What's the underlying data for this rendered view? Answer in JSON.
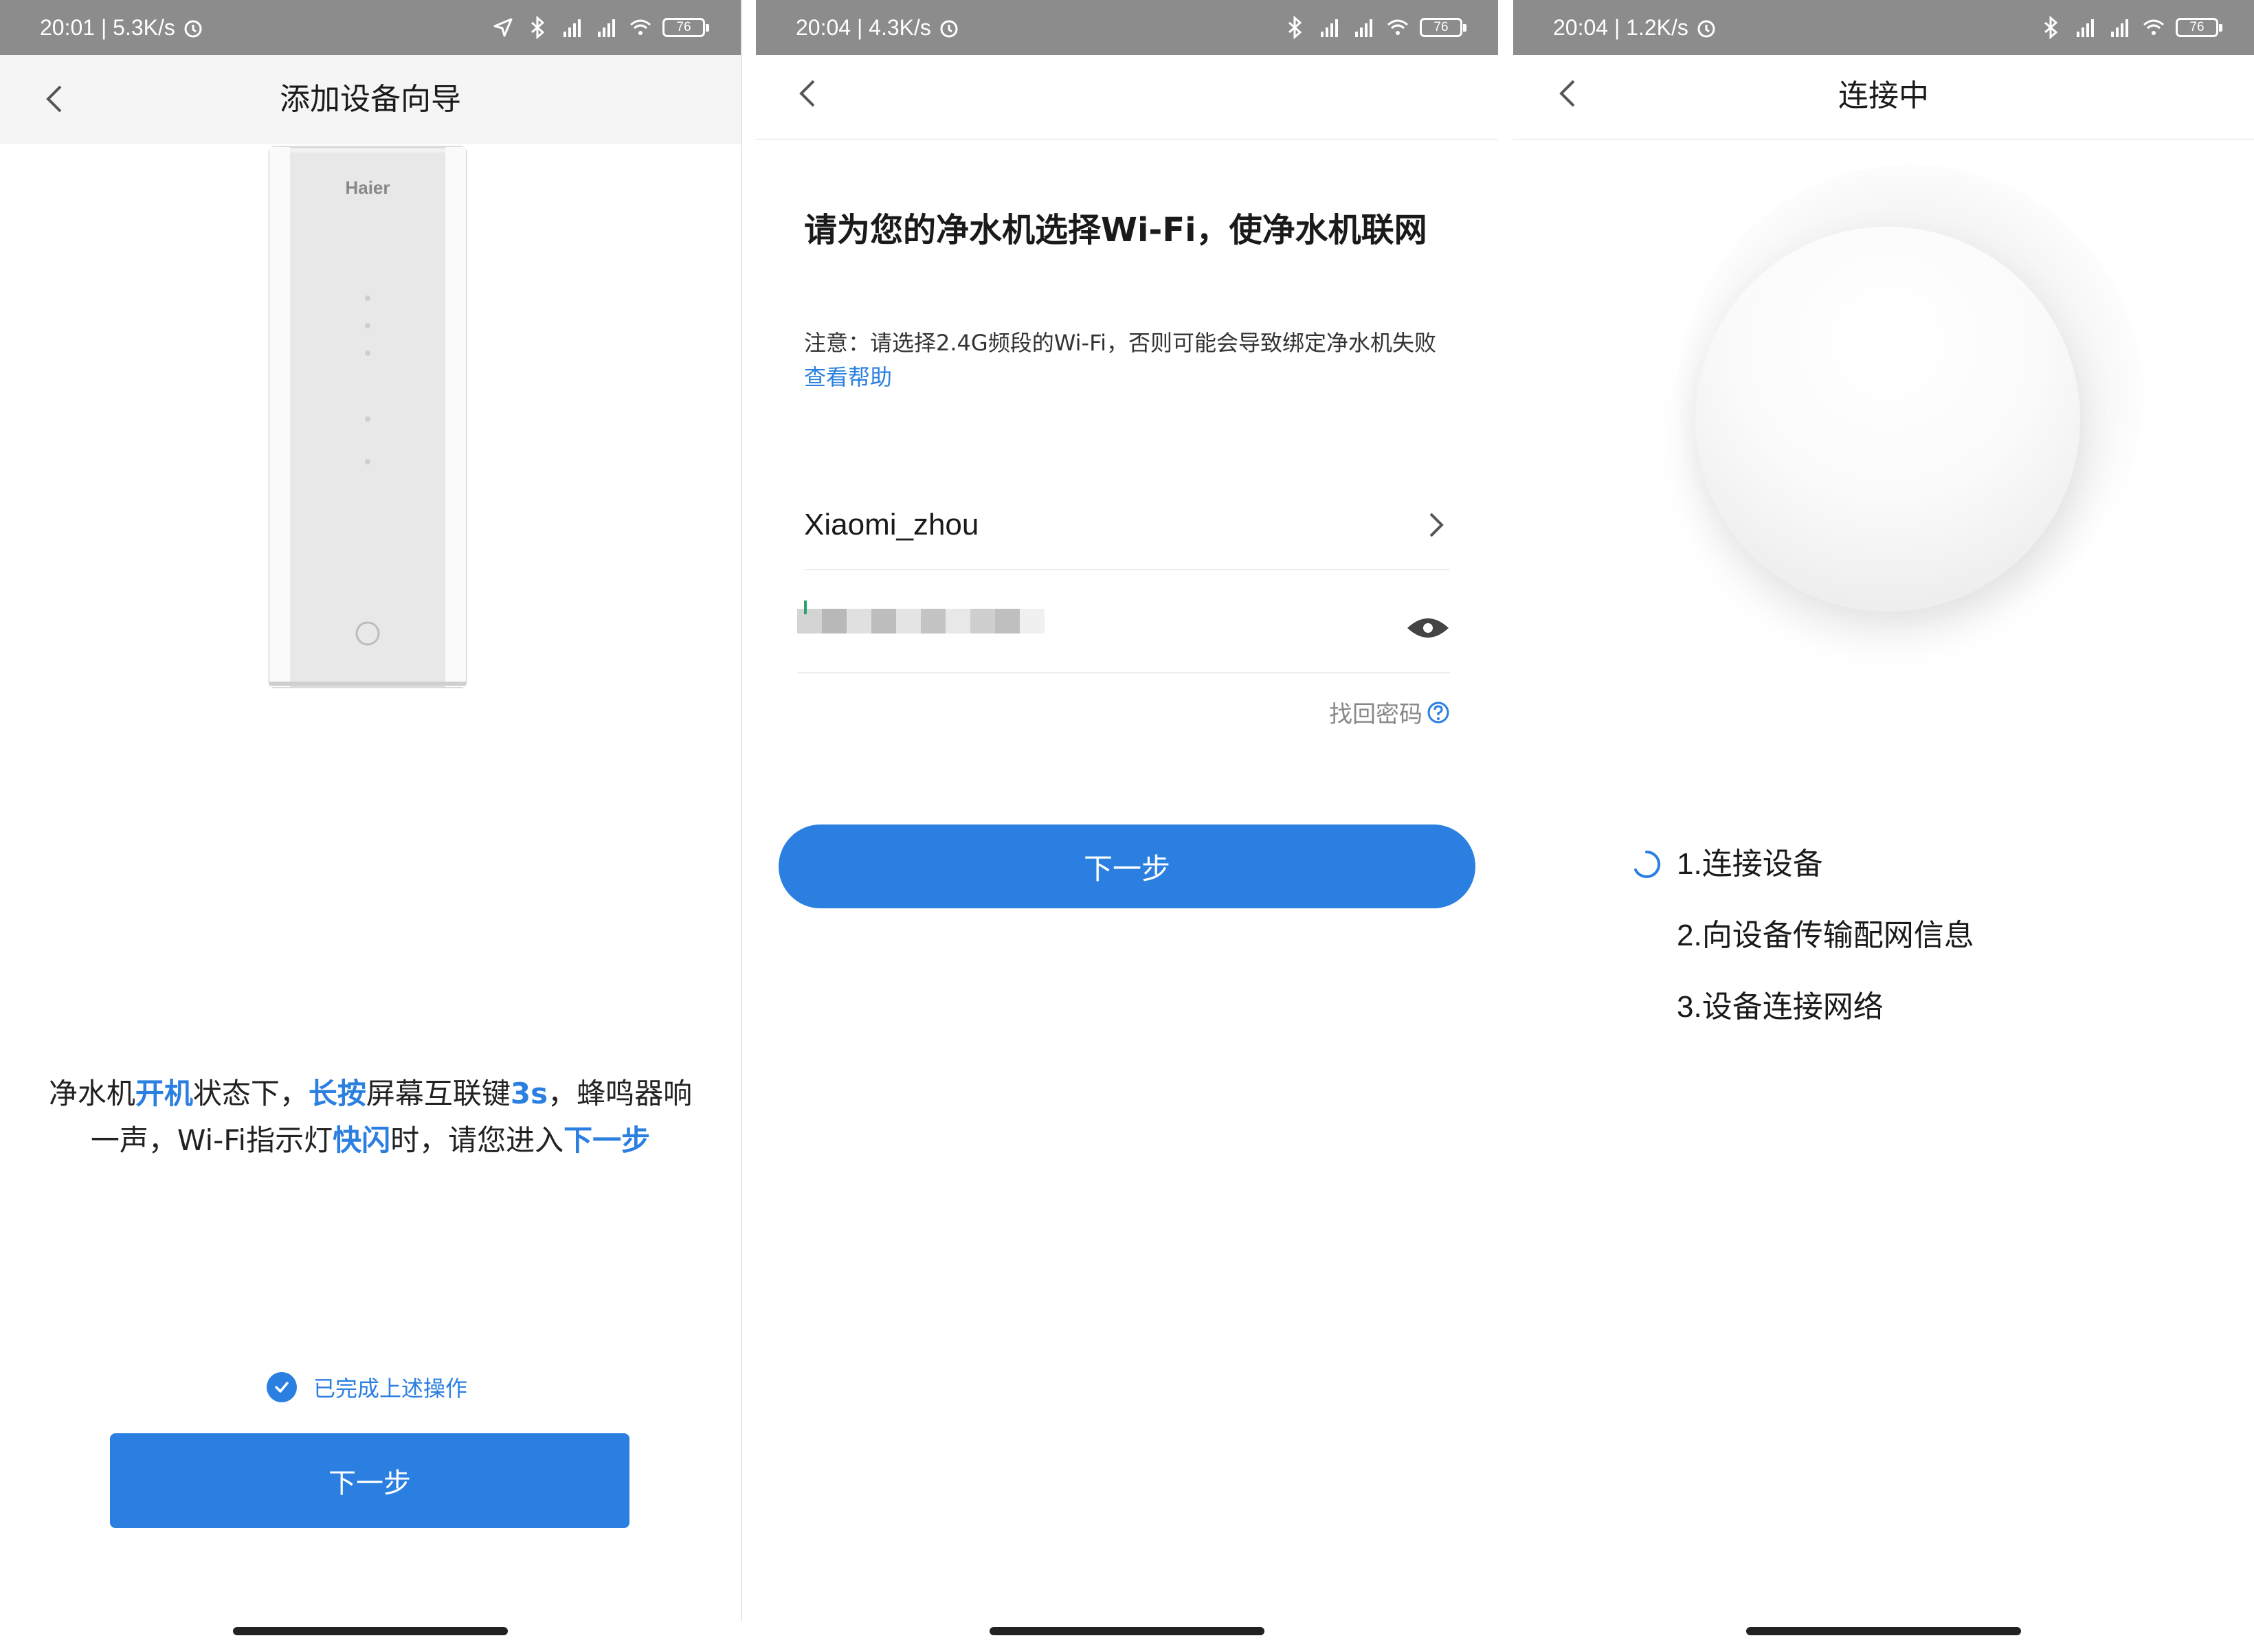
{
  "colors": {
    "accent": "#2a7fe0",
    "status_bar": "#8c8c8c",
    "text": "#1a1a1a"
  },
  "panel1": {
    "status": {
      "time_speed": "20:01 | 5.3K/s",
      "battery": "76"
    },
    "title": "添加设备向导",
    "device_brand": "Haier",
    "instruction": {
      "t1": "净水机",
      "h1": "开机",
      "t2": "状态下，",
      "h2": "长按",
      "t3": "屏幕互联键",
      "h3": "3s",
      "t4": "，蜂鸣器响一声，Wi-Fi指示灯",
      "h4": "快闪",
      "t5": "时，请您进入",
      "h5": "下一步"
    },
    "confirm_label": "已完成上述操作",
    "next_label": "下一步"
  },
  "panel2": {
    "status": {
      "time_speed": "20:04 | 4.3K/s",
      "battery": "76"
    },
    "heading": "请为您的净水机选择Wi-Fi，使净水机联网",
    "note": "注意：请选择2.4G频段的Wi-Fi，否则可能会导致绑定净水机失败",
    "help_link": "查看帮助",
    "wifi_name": "Xiaomi_zhou",
    "forgot_password": "找回密码",
    "next_label": "下一步"
  },
  "panel3": {
    "status": {
      "time_speed": "20:04 | 1.2K/s",
      "battery": "76"
    },
    "title": "连接中",
    "steps": [
      "1.连接设备",
      "2.向设备传输配网信息",
      "3.设备连接网络"
    ]
  }
}
